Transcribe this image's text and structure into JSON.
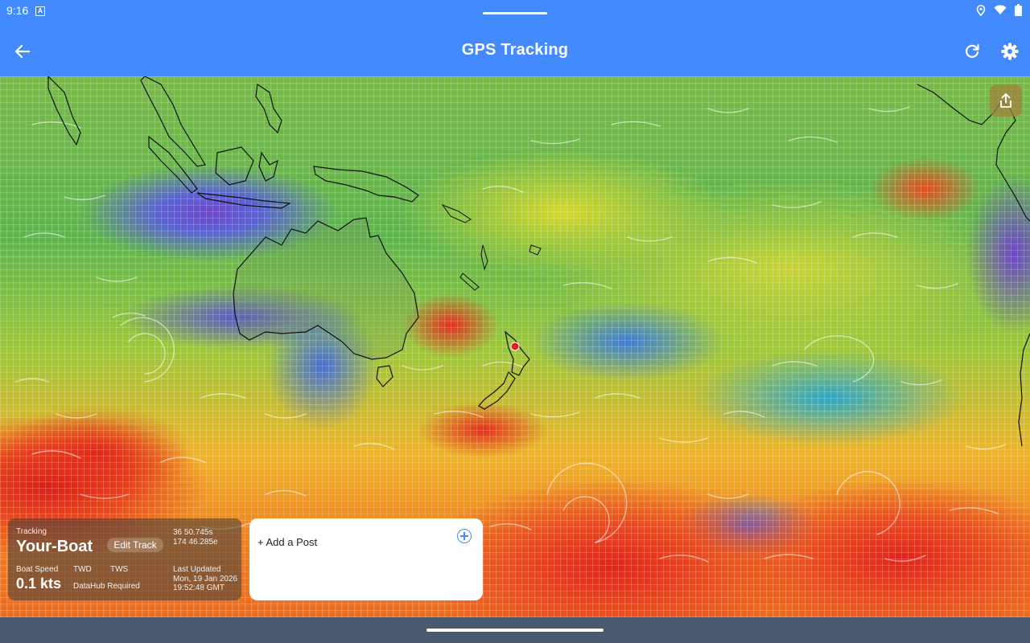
{
  "status_bar": {
    "time": "9:16",
    "notification_badge": "A",
    "icons": [
      "location-icon",
      "wifi-icon",
      "battery-icon"
    ]
  },
  "app_bar": {
    "title": "GPS Tracking",
    "icons": [
      "back-arrow-icon",
      "refresh-icon",
      "settings-gear-icon"
    ]
  },
  "map": {
    "layer": "wind-speed-heatmap",
    "share_icon": "share-icon",
    "boat_marker_color": "#e02020"
  },
  "tracking_card": {
    "tracking_label": "Tracking",
    "boat_name": "Your-Boat",
    "edit_track_label": "Edit Track",
    "latitude": "36 50.745s",
    "longitude": "174 46.285e",
    "boat_speed_label": "Boat Speed",
    "boat_speed_value": "0.1 kts",
    "twd_label": "TWD",
    "tws_label": "TWS",
    "datahub_text": "DataHub Required",
    "last_updated_label": "Last Updated",
    "last_updated_date": "Mon, 19 Jan 2026",
    "last_updated_time": "19:52:48 GMT"
  },
  "post_card": {
    "add_post_label": "+ Add a Post",
    "add_icon": "plus-circle-icon"
  },
  "colors": {
    "accent": "#448aff",
    "nav_bar": "#4a5a6e"
  }
}
